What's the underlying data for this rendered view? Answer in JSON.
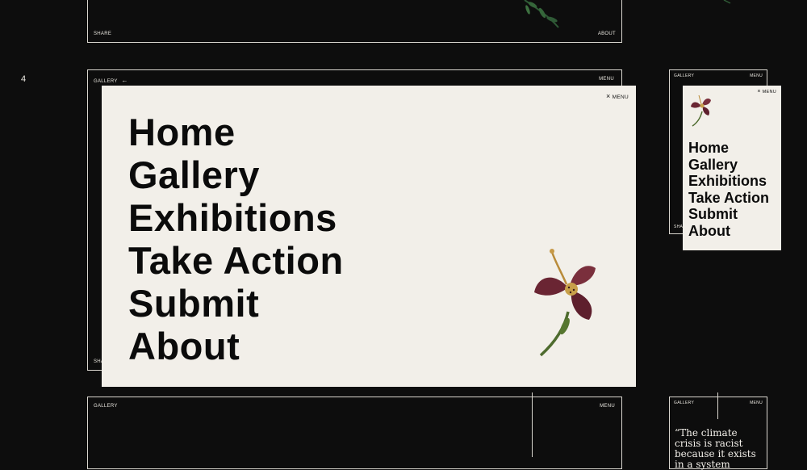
{
  "step_number": "4",
  "top_frame": {
    "share": "SHARE",
    "about": "ABOUT"
  },
  "main_frame": {
    "gallery": "GALLERY",
    "back_arrow": "←",
    "menu": "MENU",
    "share_partial": "SHA"
  },
  "menu_overlay": {
    "close_icon": "×",
    "close_label": "MENU",
    "items": [
      "Home",
      "Gallery",
      "Exhibitions",
      "Take Action",
      "Submit",
      "About"
    ]
  },
  "mobile_frame": {
    "gallery": "GALLERY",
    "menu": "MENU",
    "share_partial": "SHA"
  },
  "mobile_menu": {
    "close_icon": "×",
    "close_label": "MENU",
    "items": [
      "Home",
      "Gallery",
      "Exhibitions",
      "Take Action",
      "Submit",
      "About"
    ]
  },
  "bottom_frame": {
    "gallery": "GALLERY",
    "menu": "MENU"
  },
  "bottom_mobile": {
    "gallery": "GALLERY",
    "menu": "MENU",
    "quote": "“The climate crisis is racist because it exists in a system"
  },
  "colors": {
    "background": "#0d0d0d",
    "panel": "#f2efe9",
    "ink": "#0b0b0b",
    "flower": "#6e2a37",
    "stem": "#4e6b2e"
  }
}
